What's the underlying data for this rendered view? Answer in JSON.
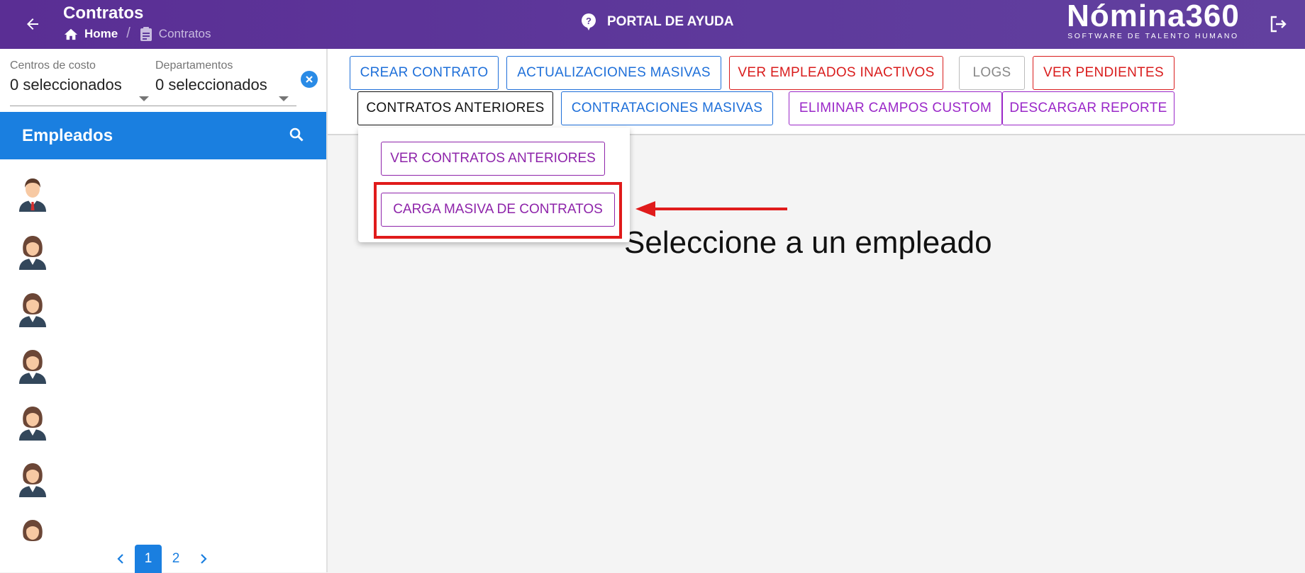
{
  "header": {
    "title": "Contratos",
    "breadcrumb": {
      "home": "Home",
      "current": "Contratos"
    },
    "help_label": "PORTAL DE AYUDA",
    "logo": {
      "name": "Nómina360",
      "tagline": "SOFTWARE DE TALENTO HUMANO"
    }
  },
  "sidebar": {
    "filters": [
      {
        "label": "Centros de costo",
        "value": "0 seleccionados"
      },
      {
        "label": "Departamentos",
        "value": "0 seleccionados"
      }
    ],
    "employees_title": "Empleados",
    "employee_avatars": [
      "male",
      "female",
      "female",
      "female",
      "female",
      "female",
      "female"
    ],
    "pagination": {
      "pages": [
        "1",
        "2"
      ],
      "current": "1"
    }
  },
  "toolbar": {
    "row1": [
      "CREAR CONTRATO",
      "ACTUALIZACIONES MASIVAS",
      "VER EMPLEADOS INACTIVOS",
      "LOGS",
      "VER PENDIENTES"
    ],
    "row2": [
      "CONTRATOS ANTERIORES",
      "CONTRATACIONES MASIVAS",
      "ELIMINAR CAMPOS CUSTOM",
      "DESCARGAR REPORTE"
    ]
  },
  "dropdown": {
    "items": [
      "VER CONTRATOS ANTERIORES",
      "CARGA MASIVA DE CONTRATOS"
    ]
  },
  "main": {
    "message": "Seleccione a un empleado"
  },
  "colors": {
    "header": "#5a2e94",
    "primary": "#1a7fe0",
    "danger": "#d91c1c",
    "purple": "#9a27c8",
    "highlight": "#e01b1b"
  }
}
